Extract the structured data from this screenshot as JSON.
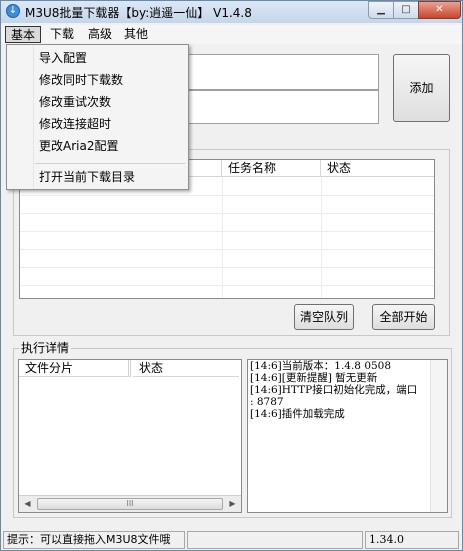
{
  "window": {
    "title": "M3U8批量下载器【by:逍遥一仙】 V1.4.8",
    "icon": "download-arrow-icon",
    "caption": {
      "minimize": "minimize-icon",
      "maximize": "maximize-icon",
      "close": "close-icon"
    }
  },
  "menubar": {
    "items": [
      {
        "label": "基本"
      },
      {
        "label": "下载"
      },
      {
        "label": "高级"
      },
      {
        "label": "其他"
      }
    ]
  },
  "dropdown": {
    "items": [
      {
        "label": "导入配置"
      },
      {
        "label": "修改同时下载数"
      },
      {
        "label": "修改重试次数"
      },
      {
        "label": "修改连接超时"
      },
      {
        "label": "更改Aria2配置"
      },
      {
        "label": "打开当前下载目录"
      }
    ]
  },
  "inputs": {
    "url_value": "",
    "name_value": ""
  },
  "buttons": {
    "add": "添加",
    "clear_queue": "清空队列",
    "start_all": "全部开始"
  },
  "task_list": {
    "columns": [
      {
        "label": "任务名称"
      },
      {
        "label": "状态"
      }
    ],
    "rows": []
  },
  "details": {
    "group_label": "执行详情",
    "columns": [
      {
        "label": "文件分片"
      },
      {
        "label": "状态"
      }
    ],
    "scroll_thumb": "III"
  },
  "log": {
    "lines": [
      "[14:6]当前版本：1.4.8 0508",
      "[14:6][更新提醒] 暂无更新",
      "[14:6]HTTP接口初始化完成，端口",
      ": 8787",
      "[14:6]插件加载完成"
    ]
  },
  "statusbar": {
    "hint": "提示：可以直接拖入M3U8文件哦",
    "middle": "",
    "version": "1.34.0"
  }
}
